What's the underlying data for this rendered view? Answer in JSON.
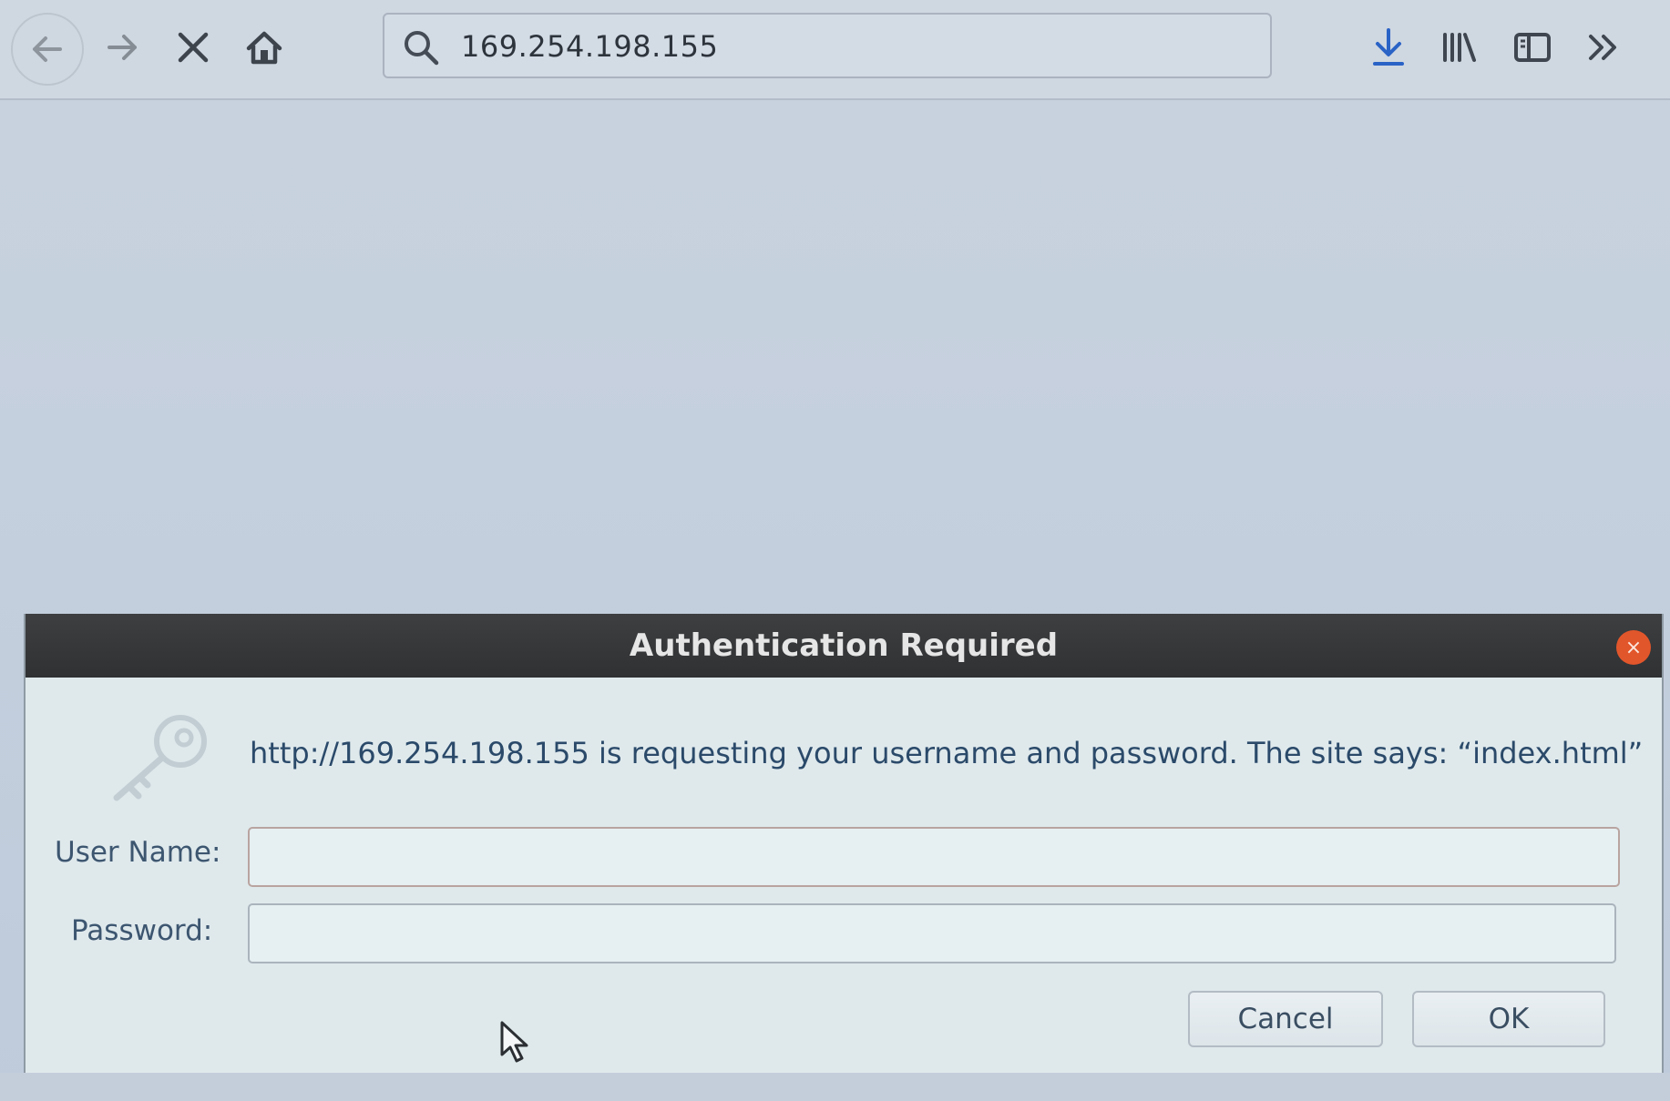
{
  "browser": {
    "toolbar": {
      "back_icon": "arrow-left-icon",
      "forward_icon": "arrow-right-icon",
      "stop_icon": "close-x-icon",
      "home_icon": "home-icon",
      "url": "169.254.198.155",
      "search_icon": "search-icon",
      "downloads_icon": "download-icon",
      "library_icon": "library-icon",
      "sidebar_icon": "sidebar-icon",
      "overflow_icon": "double-chevron-icon",
      "download_color": "#2a63c6"
    }
  },
  "dialog": {
    "title": "Authentication Required",
    "close_label": "×",
    "close_color": "#e2562b",
    "message": "http://169.254.198.155 is requesting your username and password. The site says: “index.html”",
    "username_label": "User Name:",
    "username_value": "",
    "password_label": "Password:",
    "password_value": "",
    "cancel_label": "Cancel",
    "ok_label": "OK"
  }
}
